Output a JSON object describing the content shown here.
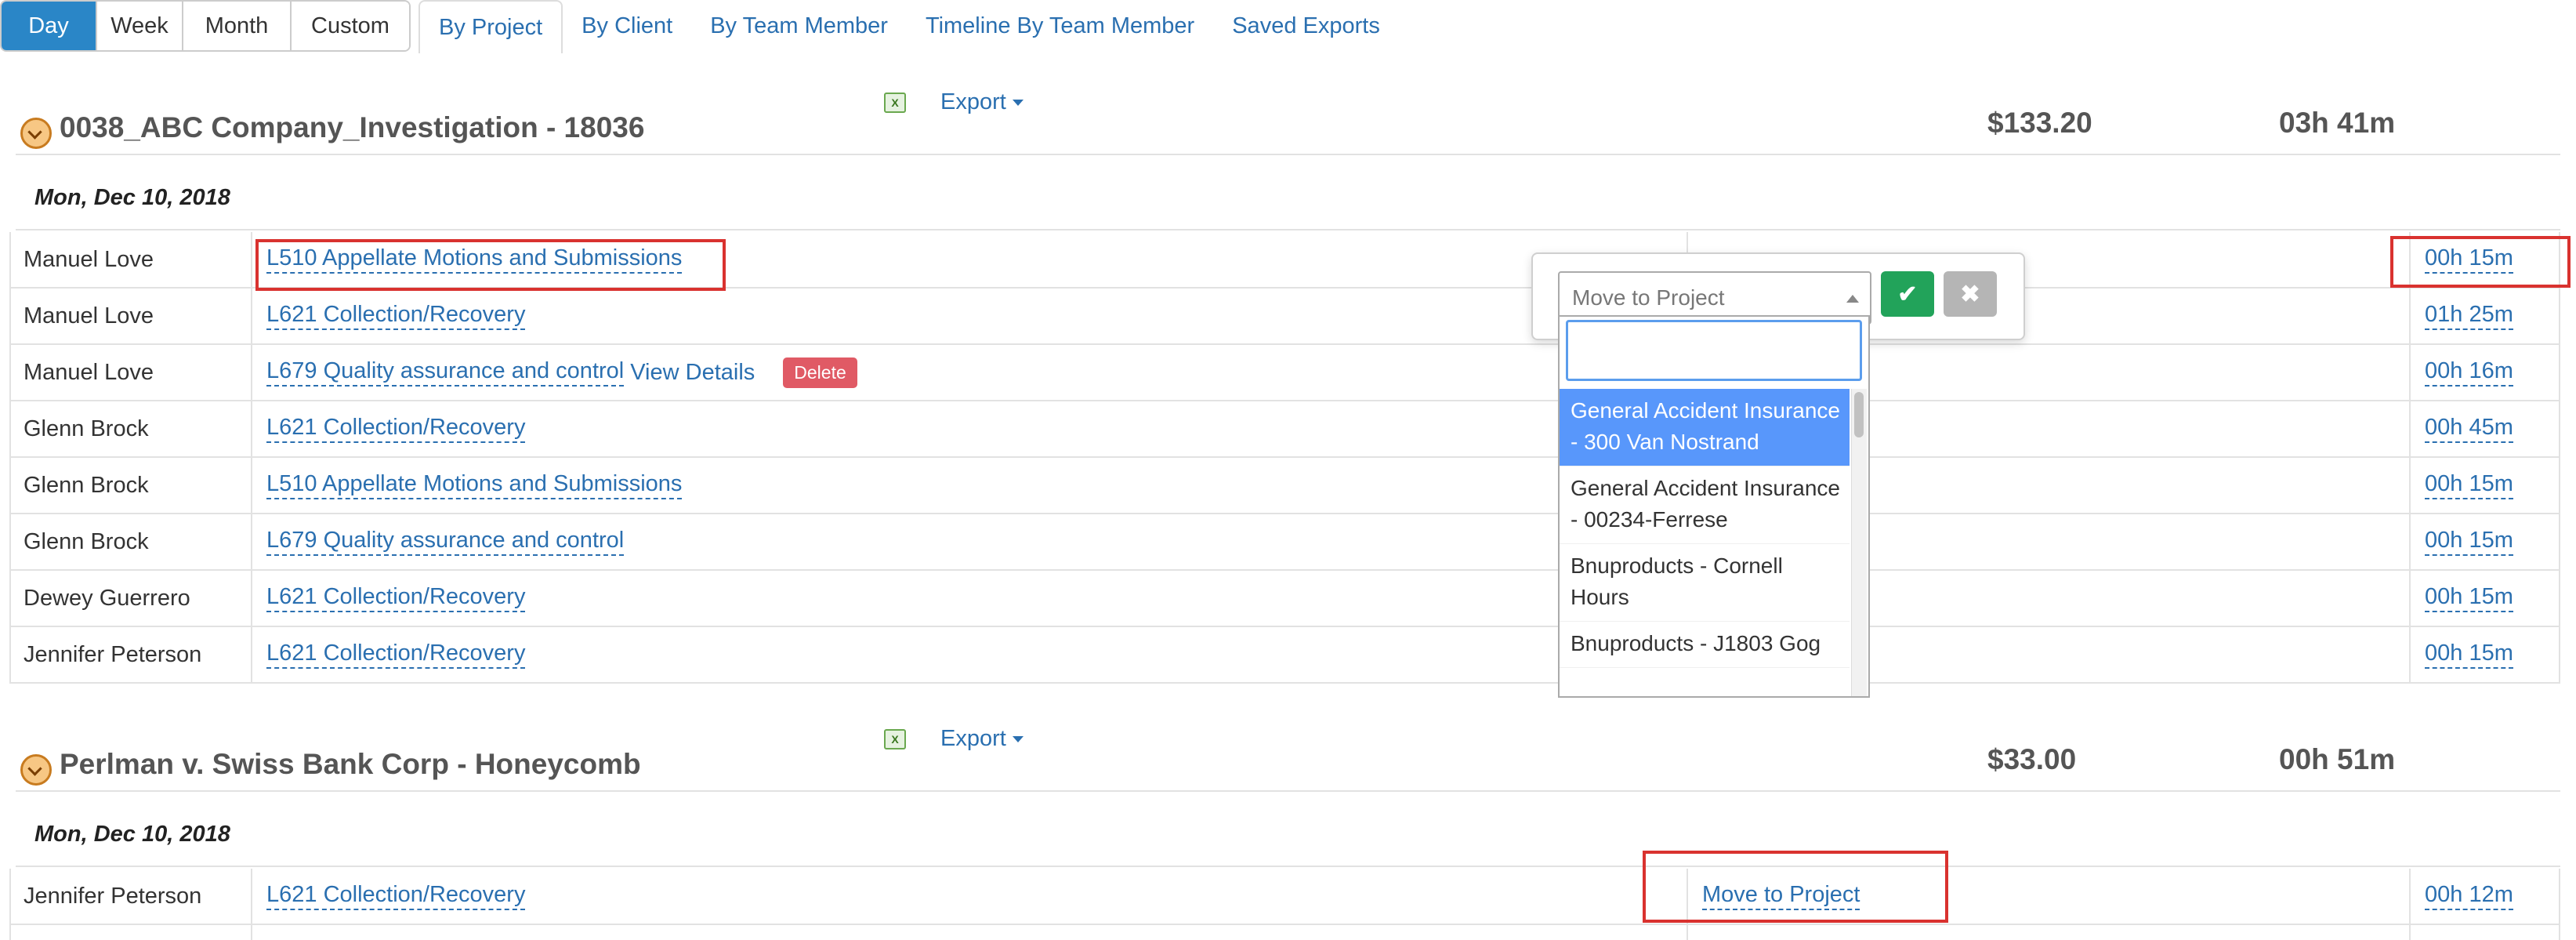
{
  "view_buttons": [
    "Day",
    "Week",
    "Month",
    "Custom"
  ],
  "tabs": [
    "By Project",
    "By Client",
    "By Team Member",
    "Timeline By Team Member",
    "Saved Exports"
  ],
  "projects": [
    {
      "title": "0038_ABC Company_Investigation - 18036",
      "export_label": "Export",
      "amount": "$133.20",
      "hours": "03h 41m",
      "date": "Mon, Dec 10, 2018",
      "rows": [
        {
          "name": "Manuel Love",
          "task": "L510 Appellate Motions and Submissions",
          "move": "",
          "duration": "00h 15m"
        },
        {
          "name": "Manuel Love",
          "task": "L621 Collection/Recovery",
          "move": "",
          "duration": "01h 25m"
        },
        {
          "name": "Manuel Love",
          "task": "L679 Quality assurance and control",
          "extra_link": "View Details",
          "badge": "Delete",
          "move": "",
          "duration": "00h 16m"
        },
        {
          "name": "Glenn Brock",
          "task": "L621 Collection/Recovery",
          "move": "",
          "duration": "00h 45m"
        },
        {
          "name": "Glenn Brock",
          "task": "L510 Appellate Motions and Submissions",
          "move": "",
          "duration": "00h 15m"
        },
        {
          "name": "Glenn Brock",
          "task": "L679 Quality assurance and control",
          "move": "",
          "duration": "00h 15m"
        },
        {
          "name": "Dewey Guerrero",
          "task": "L621 Collection/Recovery",
          "move": "",
          "duration": "00h 15m"
        },
        {
          "name": "Jennifer Peterson",
          "task": "L621 Collection/Recovery",
          "move": "",
          "duration": "00h 15m"
        }
      ]
    },
    {
      "title": "Perlman v. Swiss Bank Corp - Honeycomb",
      "export_label": "Export",
      "amount": "$33.00",
      "hours": "00h 51m",
      "date": "Mon, Dec 10, 2018",
      "rows": [
        {
          "name": "Jennifer Peterson",
          "task": "L621 Collection/Recovery",
          "move": "Move to Project",
          "duration": "00h 12m"
        }
      ]
    }
  ],
  "popover": {
    "select_placeholder": "Move to Project",
    "ok_glyph": "✔",
    "cancel_glyph": "✖",
    "options": [
      "General Accident Insurance - 300 Van Nostrand",
      "General Accident Insurance - 00234-Ferrese",
      "Bnuproducts - Cornell Hours",
      "Bnuproducts - J1803 Gog"
    ]
  },
  "excel_icon_label": "X",
  "colors": {
    "accent": "#2a86c7",
    "link": "#2a6fb0",
    "highlight_red": "#d9322f",
    "ok_green": "#22a35a",
    "delete_red": "#e05a65",
    "option_highlight": "#5897fb"
  }
}
